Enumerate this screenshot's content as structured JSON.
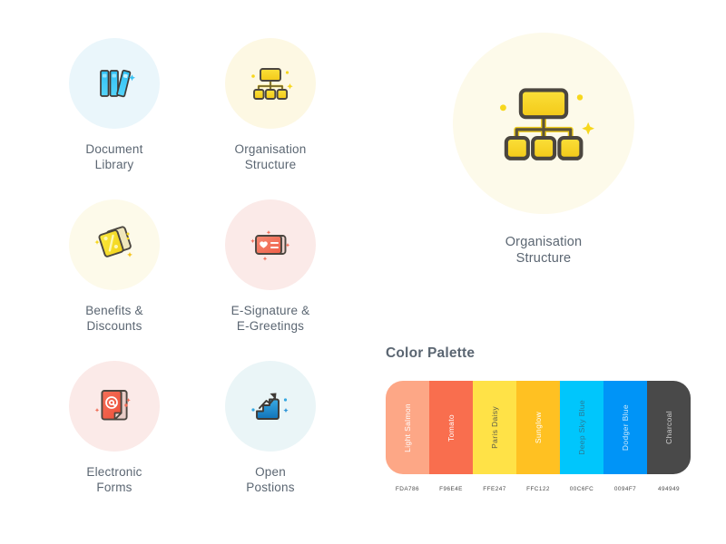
{
  "page": {
    "background": "#ffffff"
  },
  "icon_grid": {
    "items": [
      {
        "id": "document-library",
        "label": "Document\nLibrary",
        "circle_bg": "#eaf6fb",
        "icon": "books-icon",
        "accent": "#29b6f0"
      },
      {
        "id": "organisation-structure",
        "label": "Organisation\nStructure",
        "circle_bg": "#fdf8e3",
        "icon": "org-chart-icon",
        "accent": "#f5d71e"
      },
      {
        "id": "benefits-discounts",
        "label": "Benefits &\nDiscounts",
        "circle_bg": "#fdfaea",
        "icon": "price-tags-icon",
        "accent": "#f7df31"
      },
      {
        "id": "e-signature-e-greetings",
        "label": "E-Signature &\nE-Greetings",
        "circle_bg": "#fbeae8",
        "icon": "greeting-card-icon",
        "accent": "#f0644f"
      },
      {
        "id": "electronic-forms",
        "label": "Electronic\nForms",
        "circle_bg": "#fbeae8",
        "icon": "email-document-icon",
        "accent": "#f05a43"
      },
      {
        "id": "open-positions",
        "label": "Open\nPostions",
        "circle_bg": "#eaf5f7",
        "icon": "stairs-growth-icon",
        "accent": "#1e8fd8"
      }
    ]
  },
  "hero": {
    "label": "Organisation\nStructure",
    "circle_bg": "#fdfaea",
    "icon": "org-chart-icon"
  },
  "palette": {
    "title": "Color Palette",
    "swatches": [
      {
        "name": "Light Salmon",
        "hex_label": "FDA786",
        "color": "#FDA786",
        "text_color": "#ffffff"
      },
      {
        "name": "Tomato",
        "hex_label": "F96E4E",
        "color": "#F96E4E",
        "text_color": "#ffffff"
      },
      {
        "name": "Paris Daisy",
        "hex_label": "FFE247",
        "color": "#FFE247",
        "text_color": "#5b5b4a"
      },
      {
        "name": "Sunglow",
        "hex_label": "FFC122",
        "color": "#FFC122",
        "text_color": "#ffffff"
      },
      {
        "name": "Deep Sky Blue",
        "hex_label": "00C6FC",
        "color": "#00C6FC",
        "text_color": "#2b7b95"
      },
      {
        "name": "Dodger Blue",
        "hex_label": "0094F7",
        "color": "#0094F7",
        "text_color": "#cfe9fb"
      },
      {
        "name": "Charcoal",
        "hex_label": "494949",
        "color": "#494949",
        "text_color": "#cfcfcf"
      }
    ]
  }
}
